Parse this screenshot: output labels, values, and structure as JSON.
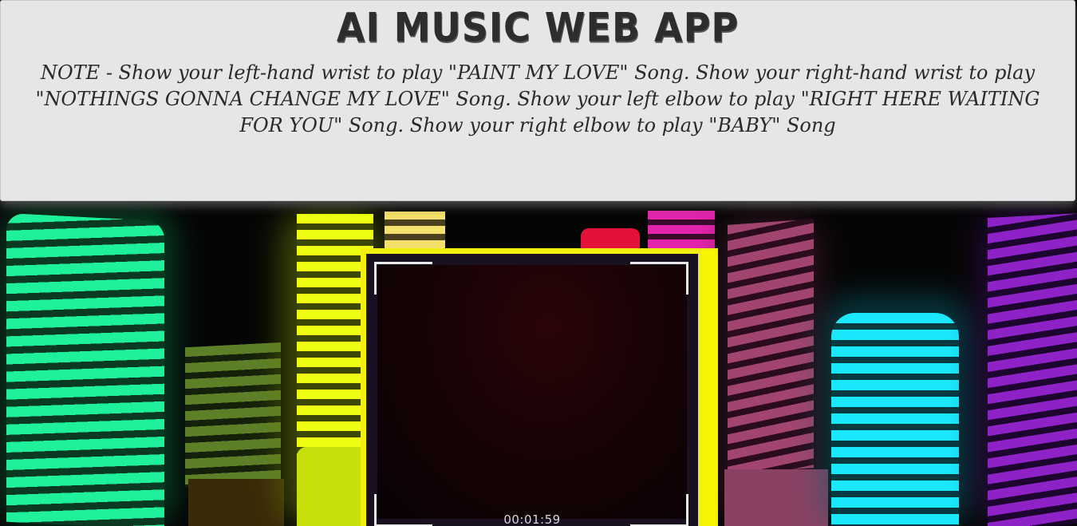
{
  "app": {
    "title": "AI MUSIC WEB APP",
    "note": "NOTE - Show your left-hand wrist to play \"PAINT MY LOVE\" Song. Show your right-hand wrist to play \"NOTHINGS GONNA CHANGE MY LOVE\" Song. Show your left elbow to play \"RIGHT HERE WAITING FOR YOU\" Song. Show your right elbow to play \"BABY\" Song"
  },
  "camera": {
    "timestamp": "00:01:59",
    "frame_color": "#f1ee10"
  },
  "colors": {
    "header_bg": "#e6e6e6",
    "title_text": "#2d2d2d",
    "eq_green": "#18e890",
    "eq_olive": "#5b7a25",
    "eq_yellow": "#e4f50a",
    "eq_pale_yellow": "#f3e36a",
    "eq_red": "#e8123a",
    "eq_magenta": "#e020a8",
    "eq_mauve": "#a2446e",
    "eq_cyan": "#16e2f5",
    "eq_purple": "#8c1fc2"
  }
}
